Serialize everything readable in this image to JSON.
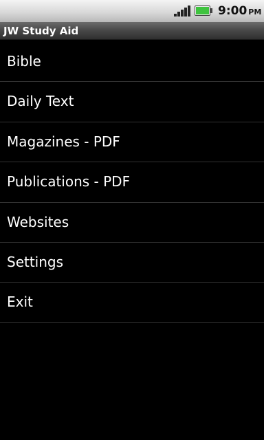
{
  "status_bar": {
    "time": "9:00",
    "ampm": "PM",
    "icons": [
      "signal-icon",
      "battery-icon"
    ],
    "battery_color": "#3fc33f"
  },
  "app": {
    "title": "JW Study Aid"
  },
  "menu": {
    "items": [
      {
        "label": "Bible"
      },
      {
        "label": "Daily Text"
      },
      {
        "label": "Magazines - PDF"
      },
      {
        "label": "Publications - PDF"
      },
      {
        "label": "Websites"
      },
      {
        "label": "Settings"
      },
      {
        "label": "Exit"
      }
    ]
  }
}
